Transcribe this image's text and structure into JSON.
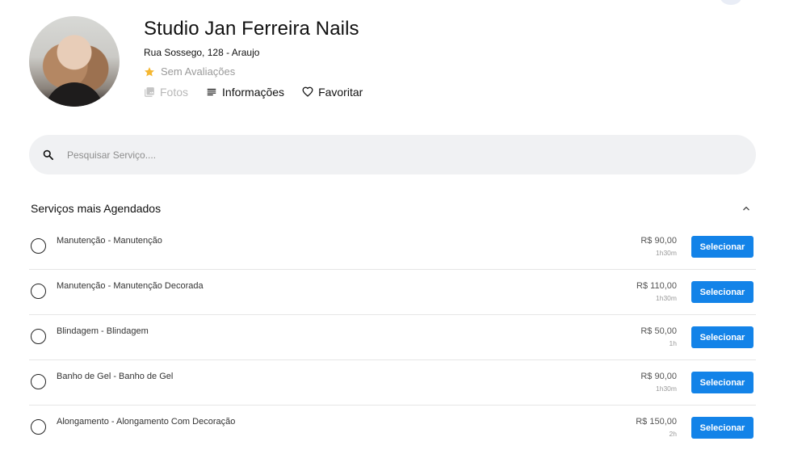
{
  "profile": {
    "name": "Studio Jan Ferreira Nails",
    "address": "Rua Sossego, 128 - Araujo",
    "rating_text": "Sem Avaliações"
  },
  "actions": {
    "photos": "Fotos",
    "info": "Informações",
    "favorite": "Favoritar"
  },
  "search": {
    "placeholder": "Pesquisar Serviço...."
  },
  "section": {
    "title": "Serviços mais Agendados"
  },
  "services": [
    {
      "name": "Manutenção - Manutenção",
      "price": "R$ 90,00",
      "duration": "1h30m",
      "button": "Selecionar"
    },
    {
      "name": "Manutenção - Manutenção Decorada",
      "price": "R$ 110,00",
      "duration": "1h30m",
      "button": "Selecionar"
    },
    {
      "name": "Blindagem - Blindagem",
      "price": "R$ 50,00",
      "duration": "1h",
      "button": "Selecionar"
    },
    {
      "name": "Banho de Gel - Banho de Gel",
      "price": "R$ 90,00",
      "duration": "1h30m",
      "button": "Selecionar"
    },
    {
      "name": "Alongamento - Alongamento Com Decoração",
      "price": "R$ 150,00",
      "duration": "2h",
      "button": "Selecionar"
    }
  ],
  "colors": {
    "accent": "#1383e8",
    "star": "#f5b731",
    "search_bg": "#f0f1f3"
  },
  "icons": {
    "star": "star-icon",
    "photos": "photos-icon",
    "info": "list-icon",
    "favorite": "heart-icon",
    "search": "search-icon",
    "collapse": "chevron-up-icon"
  }
}
